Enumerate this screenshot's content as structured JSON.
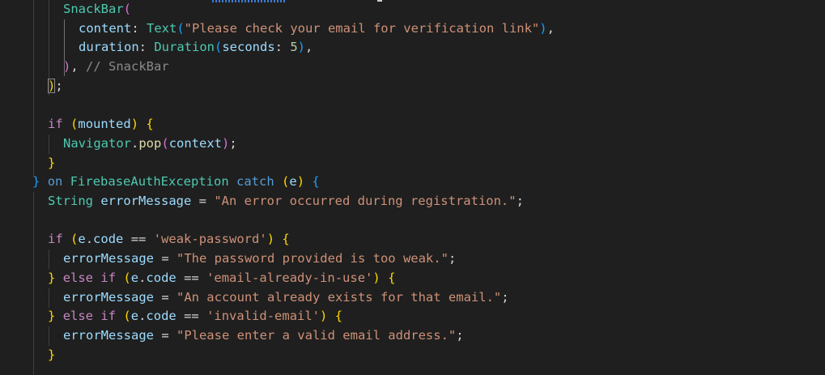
{
  "code": {
    "snackbar": "SnackBar",
    "content_key": "content",
    "text_fn": "Text",
    "msg_verify": "\"Please check your email for verification link\"",
    "duration_key": "duration",
    "duration_fn": "Duration",
    "seconds_key": "seconds",
    "seconds_val": "5",
    "snackbar_comment": "// SnackBar",
    "if_kw": "if",
    "mounted": "mounted",
    "navigator": "Navigator",
    "pop": "pop",
    "context": "context",
    "on_kw": "on",
    "exception_type": "FirebaseAuthException",
    "catch_kw": "catch",
    "e_var": "e",
    "string_type": "String",
    "error_var": "errorMessage",
    "msg_default": "\"An error occurred during registration.\"",
    "code_prop": "code",
    "weak_password": "'weak-password'",
    "msg_weak": "\"The password provided is too weak.\"",
    "else_kw": "else",
    "email_in_use": "'email-already-in-use'",
    "msg_exists": "\"An account already exists for that email.\"",
    "invalid_email": "'invalid-email'",
    "msg_invalid": "\"Please enter a valid email address.\""
  }
}
